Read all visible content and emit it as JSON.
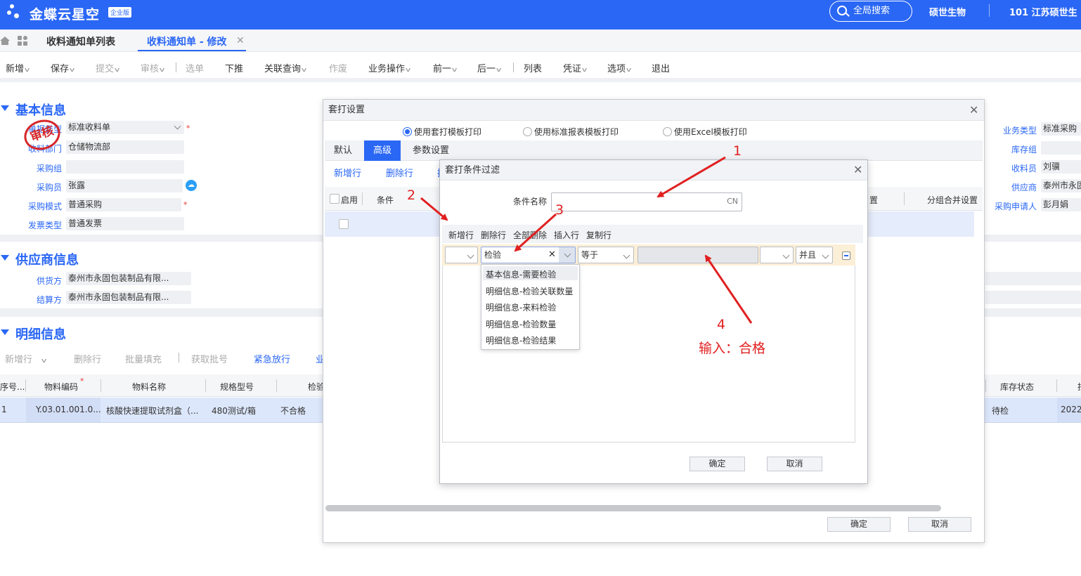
{
  "app": {
    "brand": "金蝶云星空",
    "edition": "企业版",
    "search": "全局搜索",
    "company": "硕世生物",
    "org": "101 江苏硕世生"
  },
  "tabs": [
    {
      "label": "收料通知单列表"
    },
    {
      "label": "收料通知单 - 修改"
    }
  ],
  "toolbar": [
    "新增",
    "保存",
    "提交",
    "审核",
    "选单",
    "下推",
    "关联查询",
    "作废",
    "业务操作",
    "前一",
    "后一",
    "列表",
    "凭证",
    "选项",
    "退出"
  ],
  "basic": {
    "title": "基本信息",
    "stamp": "审核",
    "rows": [
      {
        "label": "单据类型",
        "value": "标准收料单"
      },
      {
        "label": "收料部门",
        "value": "仓储物流部"
      },
      {
        "label": "采购组",
        "value": ""
      },
      {
        "label": "采购员",
        "value": "张露"
      },
      {
        "label": "采购模式",
        "value": "普通采购"
      },
      {
        "label": "发票类型",
        "value": "普通发票"
      }
    ],
    "right": [
      {
        "label": "业务类型",
        "value": "标准采购"
      },
      {
        "label": "库存组",
        "value": ""
      },
      {
        "label": "收料员",
        "value": "刘骥"
      },
      {
        "label": "供应商",
        "value": "泰州市永固"
      },
      {
        "label": "采购申请人",
        "value": "彭月娟"
      }
    ]
  },
  "supplier": {
    "title": "供应商信息",
    "rows": [
      {
        "label": "供货方",
        "value": "泰州市永固包装制品有限..."
      },
      {
        "label": "结算方",
        "value": "泰州市永固包装制品有限..."
      }
    ]
  },
  "detail": {
    "title": "明细信息",
    "actions": [
      "新增行",
      "删除行",
      "批量填充",
      "获取批号",
      "紧急放行",
      "业"
    ],
    "columns": [
      "序号...",
      "物料编码",
      "物料名称",
      "规格型号",
      "检验",
      "库存状态",
      "批"
    ],
    "row": {
      "seq": "1",
      "code": "Y.03.01.001.0...",
      "name": "核酸快速提取试剂盒（...",
      "spec": "480测试/箱",
      "check": "不合格",
      "stock": "待检",
      "date": "2022"
    }
  },
  "dialog1": {
    "title": "套打设置",
    "radios": [
      "使用套打模板打印",
      "使用标准报表模板打印",
      "使用Excel模板打印"
    ],
    "tabs": [
      "默认",
      "高级",
      "参数设置"
    ],
    "actions": [
      "新增行",
      "删除行",
      "插"
    ],
    "columns": [
      "启用",
      "条件",
      "置",
      "分组合并设置"
    ],
    "ok": "确定",
    "cancel": "取消"
  },
  "dialog2": {
    "title": "套打条件过滤",
    "name_label": "条件名称",
    "name_value": "",
    "lang": "CN",
    "actions": [
      "新增行",
      "删除行",
      "全部删除",
      "插入行",
      "复制行"
    ],
    "field_value": "检验",
    "operator": "等于",
    "logic": "并且",
    "dropdown": [
      "基本信息-需要检验",
      "明细信息-检验关联数量",
      "明细信息-来料检验",
      "明细信息-检验数量",
      "明细信息-检验结果"
    ],
    "ok": "确定",
    "cancel": "取消"
  },
  "annotations": {
    "n1": "1",
    "n2": "2",
    "n3": "3",
    "n4": "4",
    "note": "输入：合格"
  },
  "colors": {
    "accent": "#2a67f5",
    "annotation": "#e02020"
  }
}
